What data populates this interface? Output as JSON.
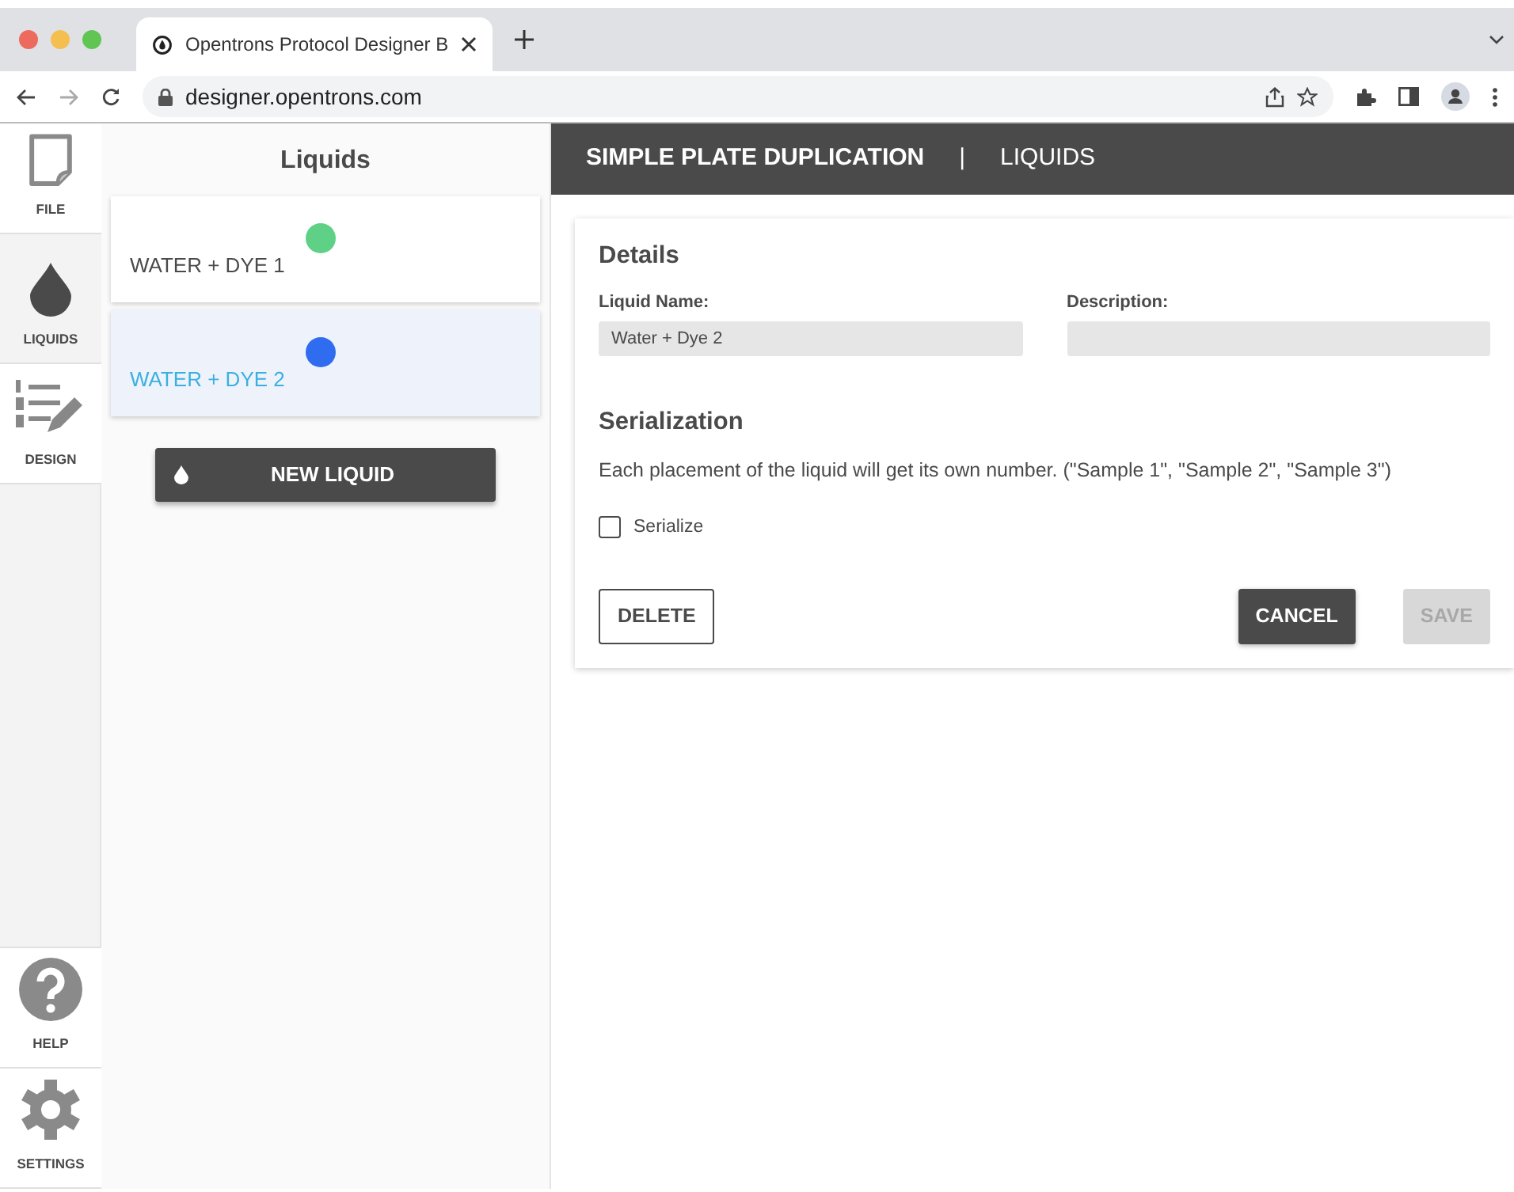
{
  "browser": {
    "tab_title": "Opentrons Protocol Designer B",
    "url": "designer.opentrons.com"
  },
  "nav": {
    "items": [
      {
        "kind": "file",
        "label": "FILE",
        "selected": false
      },
      {
        "kind": "liquids",
        "label": "LIQUIDS",
        "selected": true
      },
      {
        "kind": "design",
        "label": "DESIGN",
        "selected": false
      }
    ],
    "bottom_items": [
      {
        "kind": "help",
        "label": "HELP"
      },
      {
        "kind": "settings",
        "label": "SETTINGS"
      }
    ]
  },
  "sidebar": {
    "title": "Liquids",
    "liquids": [
      {
        "name": "WATER + DYE 1",
        "color": "#5fd186",
        "selected": false
      },
      {
        "name": "WATER + DYE 2",
        "color": "#2f6cf0",
        "selected": true
      }
    ],
    "new_button": "NEW LIQUID"
  },
  "header": {
    "protocol": "SIMPLE PLATE DUPLICATION",
    "separator": "|",
    "page": "LIQUIDS"
  },
  "form": {
    "details_title": "Details",
    "fields": [
      {
        "label": "Liquid Name:",
        "value": "Water + Dye 2"
      },
      {
        "label": "Description:"
      }
    ],
    "serialization_title": "Serialization",
    "serialization_text": "Each placement of the liquid will get its own number. (\"Sample 1\", \"Sample 2\", \"Sample 3\")",
    "serialize": {
      "label": "Serialize",
      "checked": false
    },
    "buttons": [
      {
        "label": "DELETE",
        "kind": "outline",
        "disabled": false
      },
      {
        "label": "CANCEL",
        "kind": "solid",
        "disabled": false
      },
      {
        "label": "SAVE",
        "kind": "solid",
        "disabled": true
      }
    ]
  }
}
